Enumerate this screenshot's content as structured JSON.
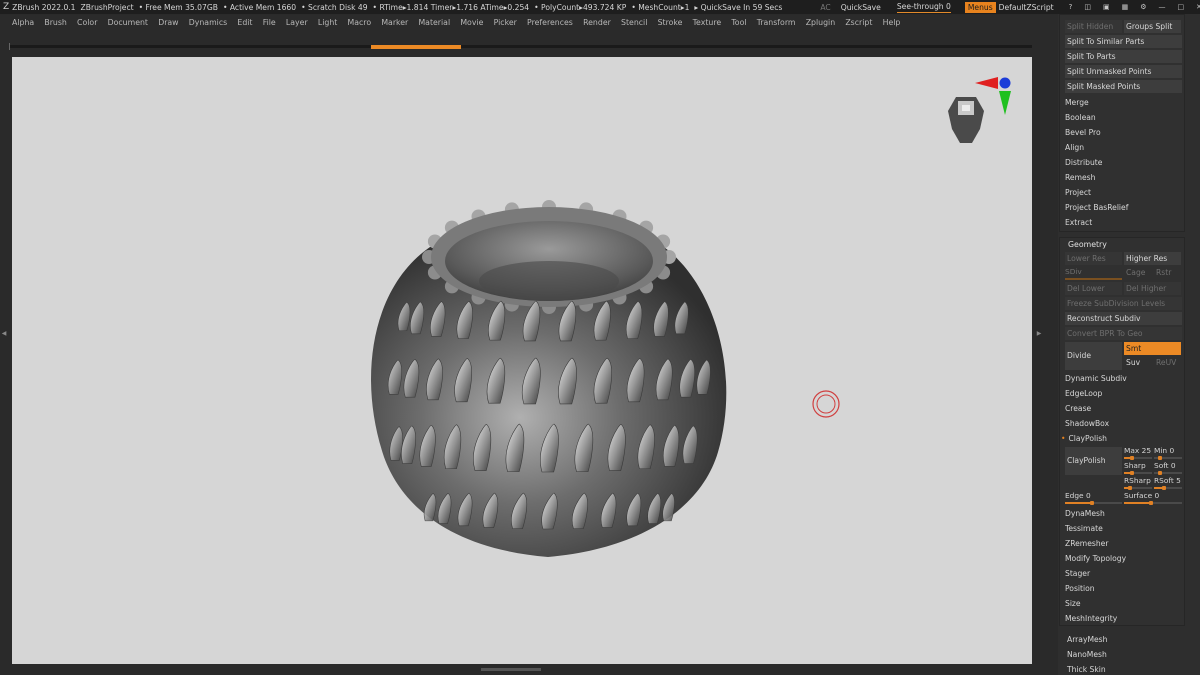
{
  "titlebar": {
    "app": "ZBrush 2022.0.1",
    "project": "ZBrushProject",
    "freemem": "• Free Mem 35.07GB",
    "activemem": "• Active Mem 1660",
    "scratch": "• Scratch Disk 49",
    "rtime": "• RTime▸1.814 Timer▸1.716 ATime▸0.254",
    "polycount": "• PolyCount▸493.724 KP",
    "meshcount": "• MeshCount▸1",
    "quicksave_in": "▸ QuickSave In 59 Secs",
    "ac": "AC",
    "quicksave": "QuickSave",
    "seethrough": "See-through  0",
    "menus": "Menus",
    "defaultzscript": "DefaultZScript"
  },
  "menu": [
    "Alpha",
    "Brush",
    "Color",
    "Document",
    "Draw",
    "Dynamics",
    "Edit",
    "File",
    "Layer",
    "Light",
    "Macro",
    "Marker",
    "Material",
    "Movie",
    "Picker",
    "Preferences",
    "Render",
    "Stencil",
    "Stroke",
    "Texture",
    "Tool",
    "Transform",
    "Zplugin",
    "Zscript",
    "Help"
  ],
  "subtools": {
    "split_hidden": "Split Hidden",
    "groups_split": "Groups Split",
    "items": [
      "Split To Similar Parts",
      "Split To Parts",
      "Split Unmasked Points",
      "Split Masked Points",
      "Merge",
      "Boolean",
      "Bevel Pro",
      "Align",
      "Distribute",
      "Remesh",
      "Project",
      "Project BasRelief",
      "Extract"
    ]
  },
  "geometry": {
    "title": "Geometry",
    "lower_res": "Lower Res",
    "higher_res": "Higher Res",
    "sdiv": "SDiv",
    "cage": "Cage",
    "rstr": "Rstr",
    "del_lower": "Del Lower",
    "del_higher": "Del Higher",
    "freeze": "Freeze SubDivision Levels",
    "reconstruct": "Reconstruct Subdiv",
    "convert_bpr": "Convert BPR To Geo",
    "divide": "Divide",
    "smt": "Smt",
    "suv": "Suv",
    "reluv": "ReUV",
    "items": [
      "Dynamic Subdiv",
      "EdgeLoop",
      "Crease",
      "ShadowBox"
    ],
    "claypolish_header": "ClayPolish",
    "claypolish_btn": "ClayPolish",
    "max": "Max 25",
    "min": "Min 0",
    "sharp": "Sharp",
    "soft": "Soft 0",
    "rsharp": "RSharp",
    "rsoft": "RSoft 5",
    "edge": "Edge 0",
    "surface": "Surface 0",
    "items2": [
      "DynaMesh",
      "Tessimate",
      "ZRemesher",
      "Modify Topology",
      "Stager",
      "Position",
      "Size",
      "MeshIntegrity"
    ]
  },
  "bottom_items": [
    "ArrayMesh",
    "NanoMesh",
    "Thick Skin"
  ],
  "colors": {
    "accent": "#ec8a25",
    "viewport_bg": "#d6d6d6",
    "panel_bg": "#2e2e2e"
  }
}
